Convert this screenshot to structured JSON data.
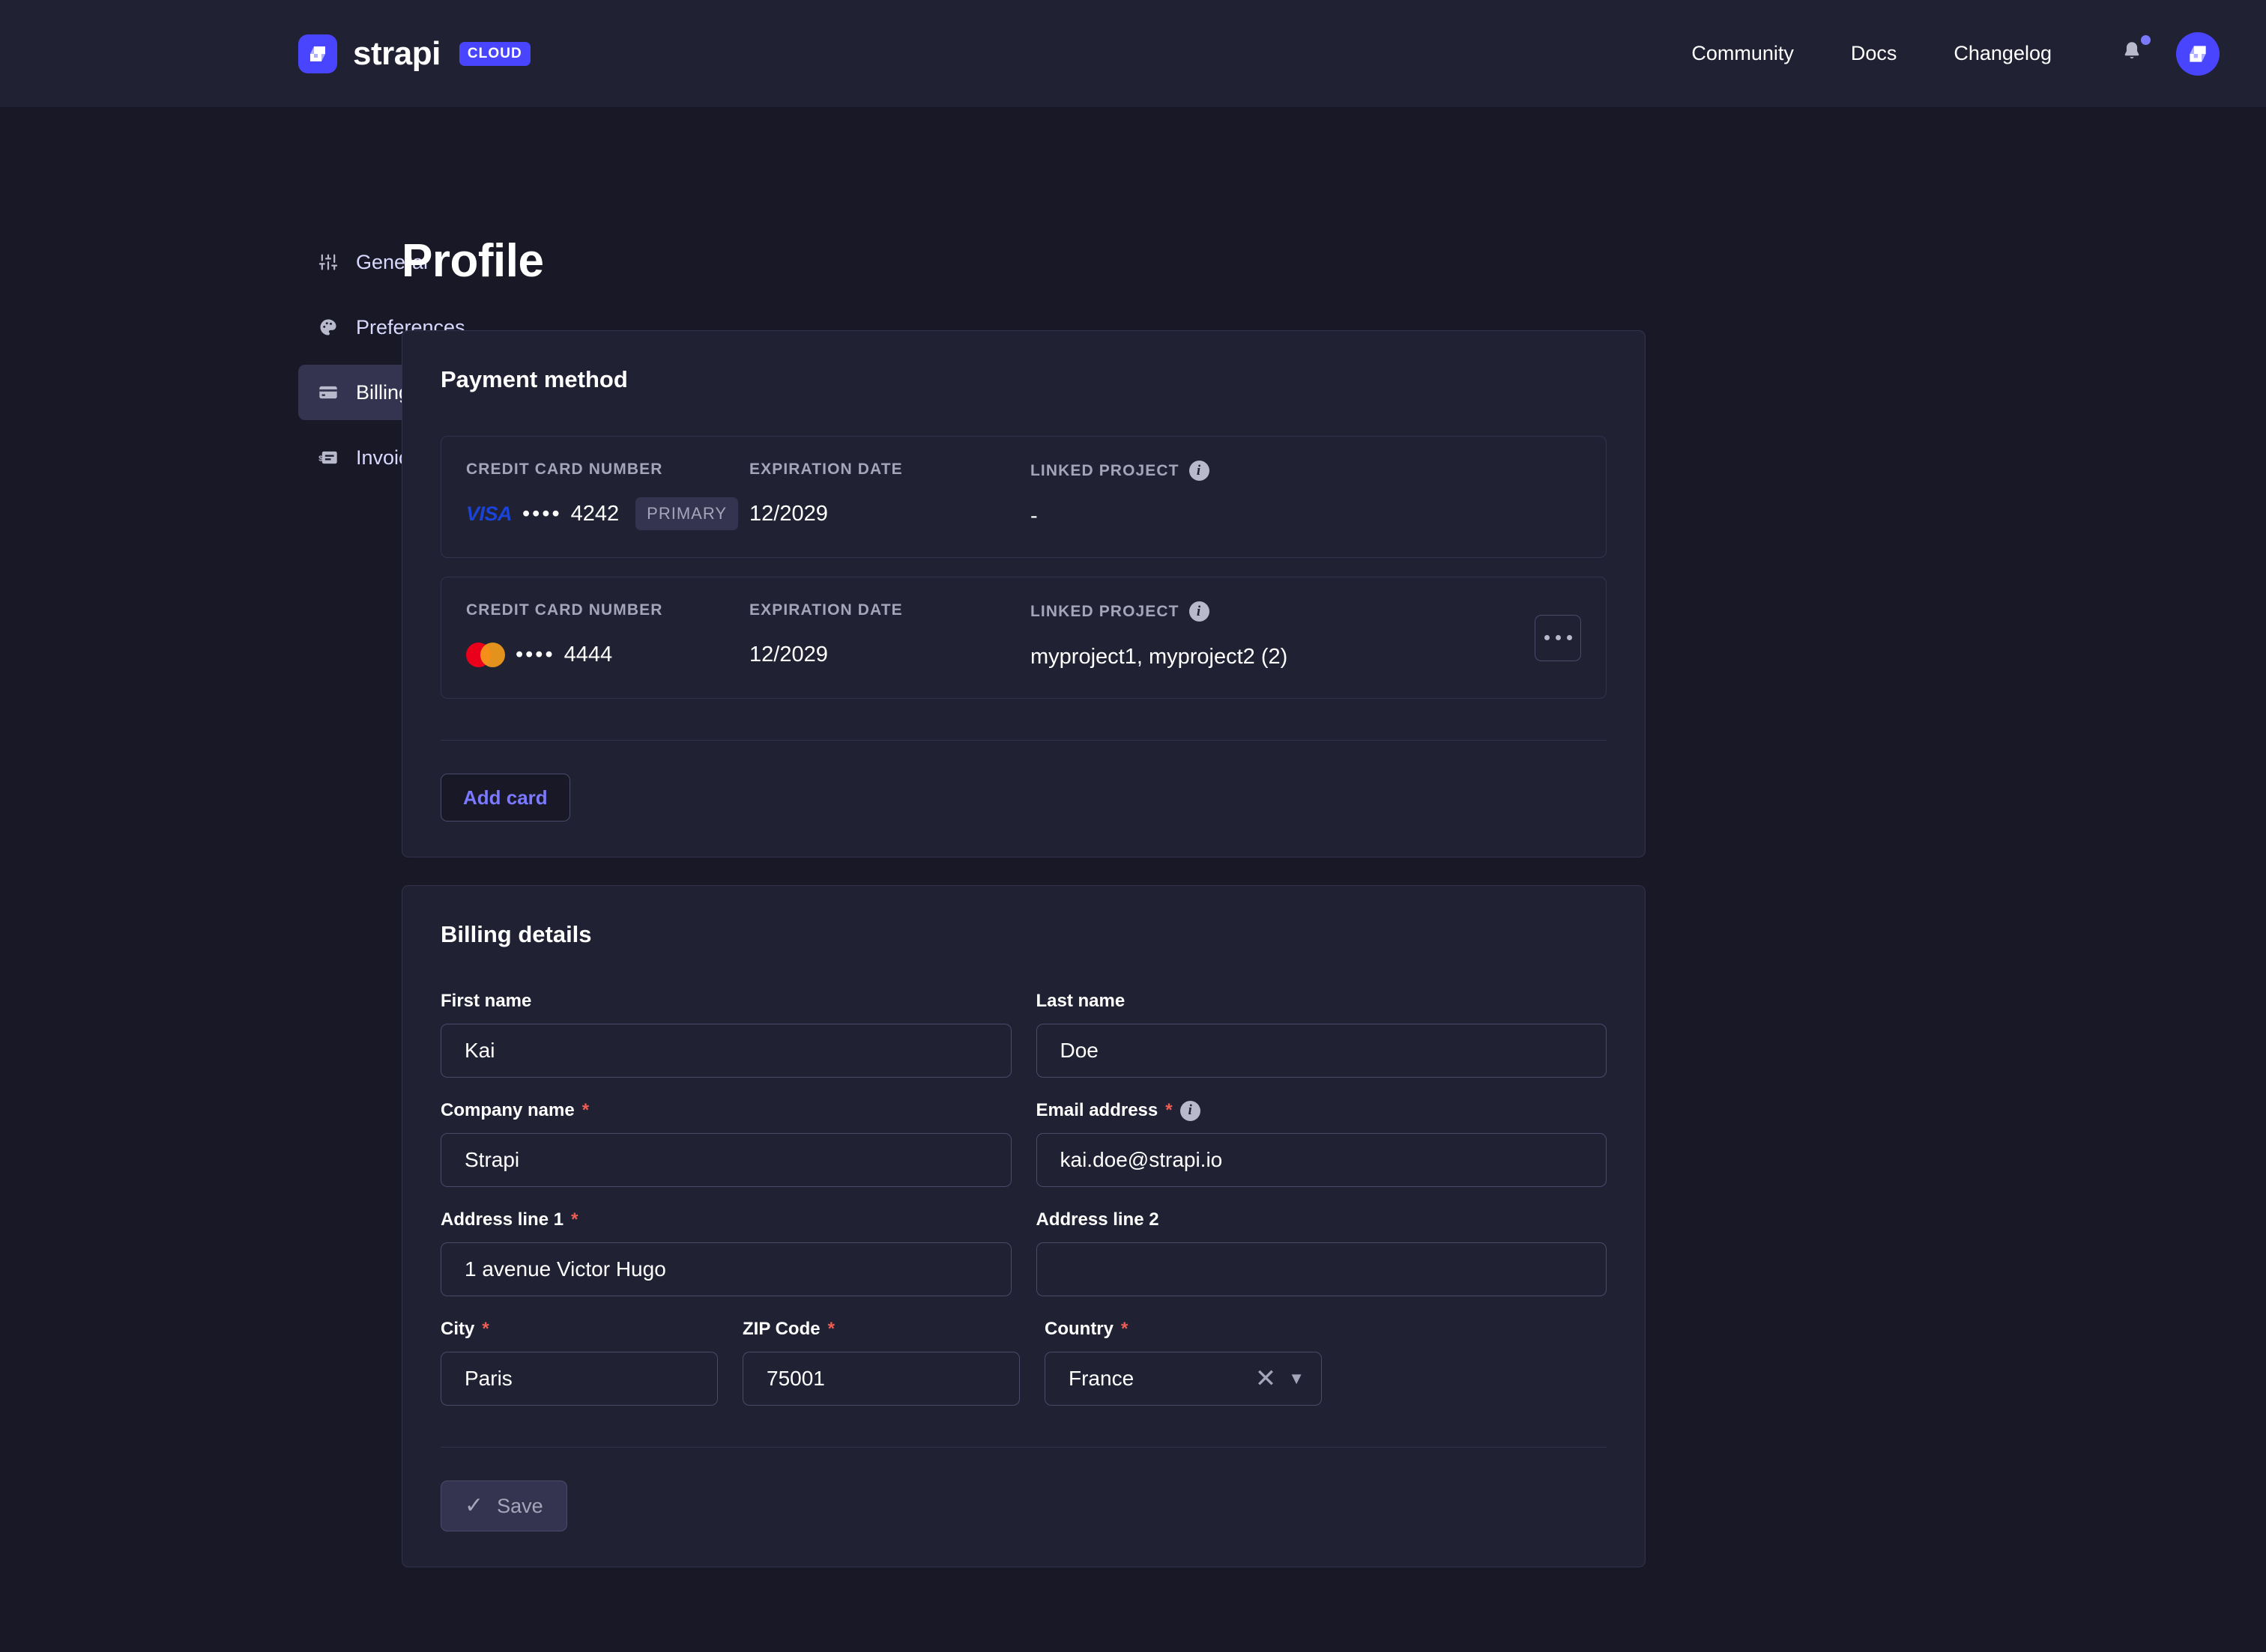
{
  "header": {
    "brand_name": "strapi",
    "brand_badge": "CLOUD",
    "nav": [
      {
        "label": "Community"
      },
      {
        "label": "Docs"
      },
      {
        "label": "Changelog"
      }
    ],
    "bell_icon": "bell-icon",
    "avatar_icon": "strapi-avatar-icon"
  },
  "sidebar": {
    "items": [
      {
        "label": "General",
        "icon": "sliders-icon",
        "active": false
      },
      {
        "label": "Preferences",
        "icon": "palette-icon",
        "active": false
      },
      {
        "label": "Billing",
        "icon": "credit-card-icon",
        "active": true
      },
      {
        "label": "Invoices",
        "icon": "receipt-icon",
        "active": false
      }
    ]
  },
  "main": {
    "page_title": "Profile",
    "payment_method": {
      "title": "Payment method",
      "columns": {
        "number": "CREDIT CARD NUMBER",
        "expiry": "EXPIRATION DATE",
        "project": "LINKED PROJECT"
      },
      "cards": [
        {
          "brand": "visa",
          "brand_label": "VISA",
          "dots": "••••",
          "last4": "4242",
          "badge": "PRIMARY",
          "expiry": "12/2029",
          "linked_project": "-",
          "has_menu": false
        },
        {
          "brand": "mastercard",
          "brand_label": "",
          "dots": "••••",
          "last4": "4444",
          "badge": "",
          "expiry": "12/2029",
          "linked_project": "myproject1, myproject2 (2)",
          "has_menu": true
        }
      ],
      "add_card_label": "Add card"
    },
    "billing_details": {
      "title": "Billing details",
      "fields": {
        "first_name": {
          "label": "First name",
          "value": "Kai",
          "required": false
        },
        "last_name": {
          "label": "Last name",
          "value": "Doe",
          "required": false
        },
        "company_name": {
          "label": "Company name",
          "value": "Strapi",
          "required": true
        },
        "email_address": {
          "label": "Email address",
          "value": "kai.doe@strapi.io",
          "required": true,
          "has_info": true
        },
        "address_1": {
          "label": "Address line 1",
          "value": "1 avenue Victor Hugo",
          "required": true
        },
        "address_2": {
          "label": "Address line 2",
          "value": "",
          "required": false
        },
        "city": {
          "label": "City",
          "value": "Paris",
          "required": true
        },
        "zip_code": {
          "label": "ZIP Code",
          "value": "75001",
          "required": true
        },
        "country": {
          "label": "Country",
          "value": "France",
          "required": true
        }
      },
      "save_label": "Save"
    }
  },
  "colors": {
    "page_bg": "#181826",
    "panel_bg": "#212134",
    "border": "#32324d",
    "accent": "#4945ff",
    "accent_text": "#7b79ff",
    "required": "#ee5e52",
    "muted": "#a5a5ba",
    "active_nav": "#343451",
    "visa_blue": "#1a43d8",
    "mc_red": "#eb001b",
    "mc_orange": "#f79e1b"
  }
}
